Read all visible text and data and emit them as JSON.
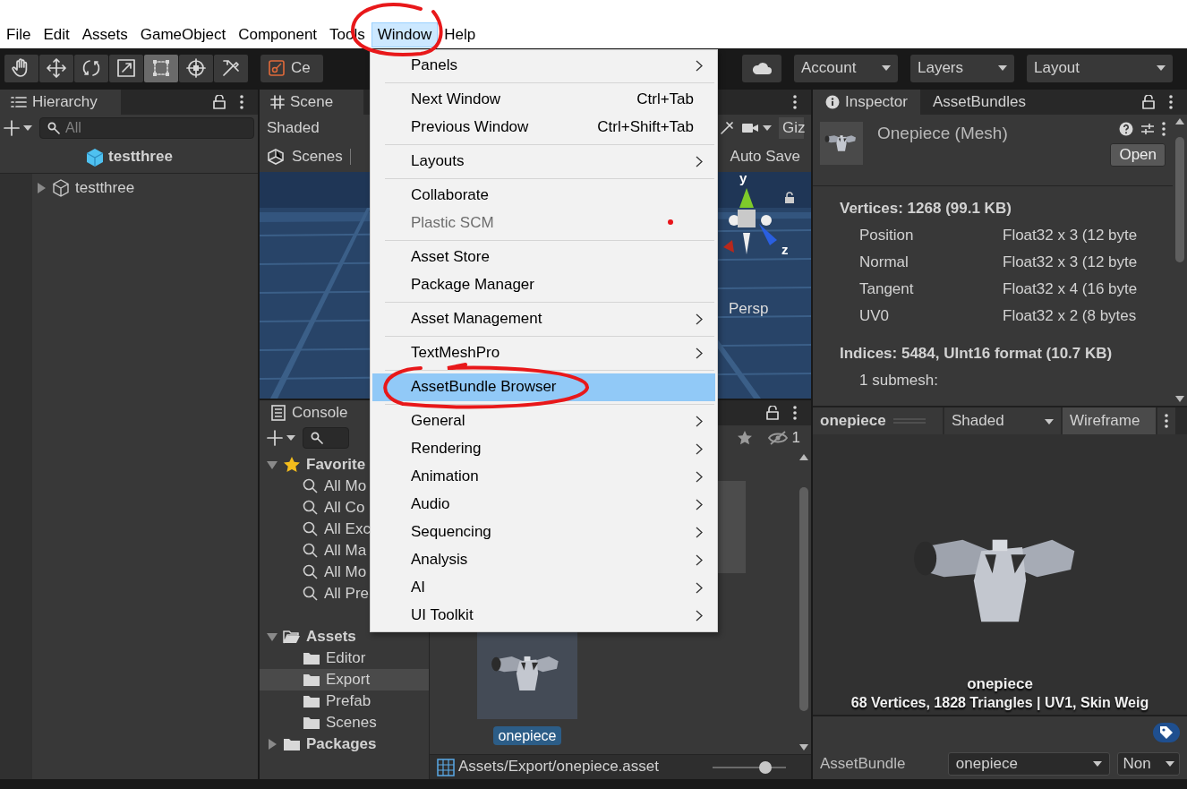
{
  "menu_bar": [
    {
      "label": "File",
      "selected": false
    },
    {
      "label": "Edit",
      "selected": false
    },
    {
      "label": "Assets",
      "selected": false
    },
    {
      "label": "GameObject",
      "selected": false
    },
    {
      "label": "Component",
      "selected": false
    },
    {
      "label": "Tools",
      "selected": false
    },
    {
      "label": "Window",
      "selected": true
    },
    {
      "label": "Help",
      "selected": false
    }
  ],
  "toolbar": {
    "tools": [
      {
        "selected": false
      },
      {
        "selected": false
      },
      {
        "selected": false
      },
      {
        "selected": false
      },
      {
        "selected": true
      },
      {
        "selected": false
      },
      {
        "selected": false
      }
    ],
    "pivot_button": "Ce",
    "dropdowns": [
      "Account",
      "Layers",
      "Layout"
    ]
  },
  "hierarchy": {
    "tab": "Hierarchy",
    "search": {
      "placeholder": "All"
    },
    "scene": "testthree",
    "rows": [
      {
        "label": "testthree",
        "expanded": false
      }
    ]
  },
  "scene_view": {
    "tab": "Scene",
    "shading": "Shaded",
    "scenes": "Scenes",
    "auto_save": "Auto Save",
    "gizmos": "Giz",
    "projection": "Persp",
    "axes": [
      "y",
      "z"
    ]
  },
  "project": {
    "tab": "Console",
    "hidden_count": "1",
    "favorites": {
      "label": "Favorite",
      "expanded": true,
      "children": [
        {
          "label": "All Mo"
        },
        {
          "label": "All Co"
        },
        {
          "label": "All Exc"
        },
        {
          "label": "All Ma"
        },
        {
          "label": "All Mo"
        },
        {
          "label": "All Pre"
        }
      ]
    },
    "folders": [
      {
        "label": "Assets",
        "expanded": true,
        "children": [
          {
            "label": "Editor",
            "selected": false
          },
          {
            "label": "Export",
            "selected": true
          },
          {
            "label": "Prefab",
            "selected": false
          },
          {
            "label": "Scenes",
            "selected": false
          }
        ]
      },
      {
        "label": "Packages",
        "expanded": false
      }
    ],
    "assets": [
      {
        "label": "onepiece",
        "selected": true
      }
    ],
    "path": "Assets/Export/onepiece.asset",
    "zoom": {
      "level": 0.72
    }
  },
  "inspector": {
    "tabs": [
      {
        "label": "Inspector",
        "selected": true
      },
      {
        "label": "AssetBundles",
        "selected": false
      }
    ],
    "title": "Onepiece (Mesh)",
    "open_button": "Open",
    "sections": [
      {
        "heading": "Vertices: 1268 (99.1 KB)",
        "rows": [
          {
            "name": "Position",
            "value": "Float32 x 3 (12 byte"
          },
          {
            "name": "Normal",
            "value": "Float32 x 3 (12 byte"
          },
          {
            "name": "Tangent",
            "value": "Float32 x 4 (16 byte"
          },
          {
            "name": "UV0",
            "value": "Float32 x 2 (8 bytes"
          }
        ]
      },
      {
        "heading": "Indices: 5484, UInt16 format (10.7 KB)",
        "rows": [
          {
            "name": "1 submesh:"
          }
        ]
      }
    ],
    "preview": {
      "title": "onepiece",
      "shading": "Shaded",
      "wireframe": "Wireframe",
      "caption": "onepiece",
      "stats": "68 Vertices, 1828 Triangles | UV1, Skin Weig"
    },
    "asset_bundle": {
      "label": "AssetBundle",
      "name": "onepiece",
      "variant": "Non"
    }
  },
  "window_menu": {
    "groups": [
      [
        {
          "label": "Panels",
          "submenu": true,
          "disabled": false,
          "selected": false,
          "notification": false
        }
      ],
      [
        {
          "label": "Next Window",
          "shortcut": "Ctrl+Tab",
          "submenu": false,
          "disabled": false,
          "selected": false,
          "notification": false
        },
        {
          "label": "Previous Window",
          "shortcut": "Ctrl+Shift+Tab",
          "submenu": false,
          "disabled": false,
          "selected": false,
          "notification": false
        }
      ],
      [
        {
          "label": "Layouts",
          "submenu": true,
          "disabled": false,
          "selected": false,
          "notification": false
        }
      ],
      [
        {
          "label": "Collaborate",
          "submenu": false,
          "disabled": false,
          "selected": false,
          "notification": false
        },
        {
          "label": "Plastic SCM",
          "submenu": false,
          "disabled": true,
          "selected": false,
          "notification": true
        }
      ],
      [
        {
          "label": "Asset Store",
          "submenu": false,
          "disabled": false,
          "selected": false,
          "notification": false
        },
        {
          "label": "Package Manager",
          "submenu": false,
          "disabled": false,
          "selected": false,
          "notification": false
        }
      ],
      [
        {
          "label": "Asset Management",
          "submenu": true,
          "disabled": false,
          "selected": false,
          "notification": false
        }
      ],
      [
        {
          "label": "TextMeshPro",
          "submenu": true,
          "disabled": false,
          "selected": false,
          "notification": false
        }
      ],
      [
        {
          "label": "AssetBundle Browser",
          "submenu": false,
          "disabled": false,
          "selected": true,
          "notification": false
        }
      ],
      [
        {
          "label": "General",
          "submenu": true,
          "disabled": false,
          "selected": false,
          "notification": false
        },
        {
          "label": "Rendering",
          "submenu": true,
          "disabled": false,
          "selected": false,
          "notification": false
        },
        {
          "label": "Animation",
          "submenu": true,
          "disabled": false,
          "selected": false,
          "notification": false
        },
        {
          "label": "Audio",
          "submenu": true,
          "disabled": false,
          "selected": false,
          "notification": false
        },
        {
          "label": "Sequencing",
          "submenu": true,
          "disabled": false,
          "selected": false,
          "notification": false
        },
        {
          "label": "Analysis",
          "submenu": true,
          "disabled": false,
          "selected": false,
          "notification": false
        },
        {
          "label": "AI",
          "submenu": true,
          "disabled": false,
          "selected": false,
          "notification": false
        },
        {
          "label": "UI Toolkit",
          "submenu": true,
          "disabled": false,
          "selected": false,
          "notification": false
        }
      ]
    ]
  }
}
